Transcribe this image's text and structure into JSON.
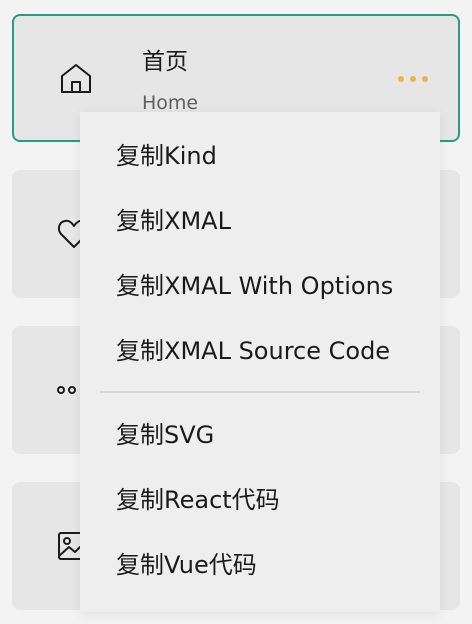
{
  "cards": [
    {
      "title": "首页",
      "subtitle": "Home",
      "icon": "home-icon",
      "selected": true
    },
    {
      "icon": "heart-icon"
    },
    {
      "icon": "dots-icon"
    },
    {
      "icon": "image-icon"
    }
  ],
  "colors": {
    "accent": "#2a9d7f",
    "more_dots": "#f0b04a"
  },
  "context_menu": {
    "items": [
      {
        "label": "复制Kind"
      },
      {
        "label": "复制XMAL"
      },
      {
        "label": "复制XMAL With Options"
      },
      {
        "label": "复制XMAL Source Code"
      },
      {
        "label": "复制SVG"
      },
      {
        "label": "复制React代码"
      },
      {
        "label": "复制Vue代码"
      }
    ]
  }
}
